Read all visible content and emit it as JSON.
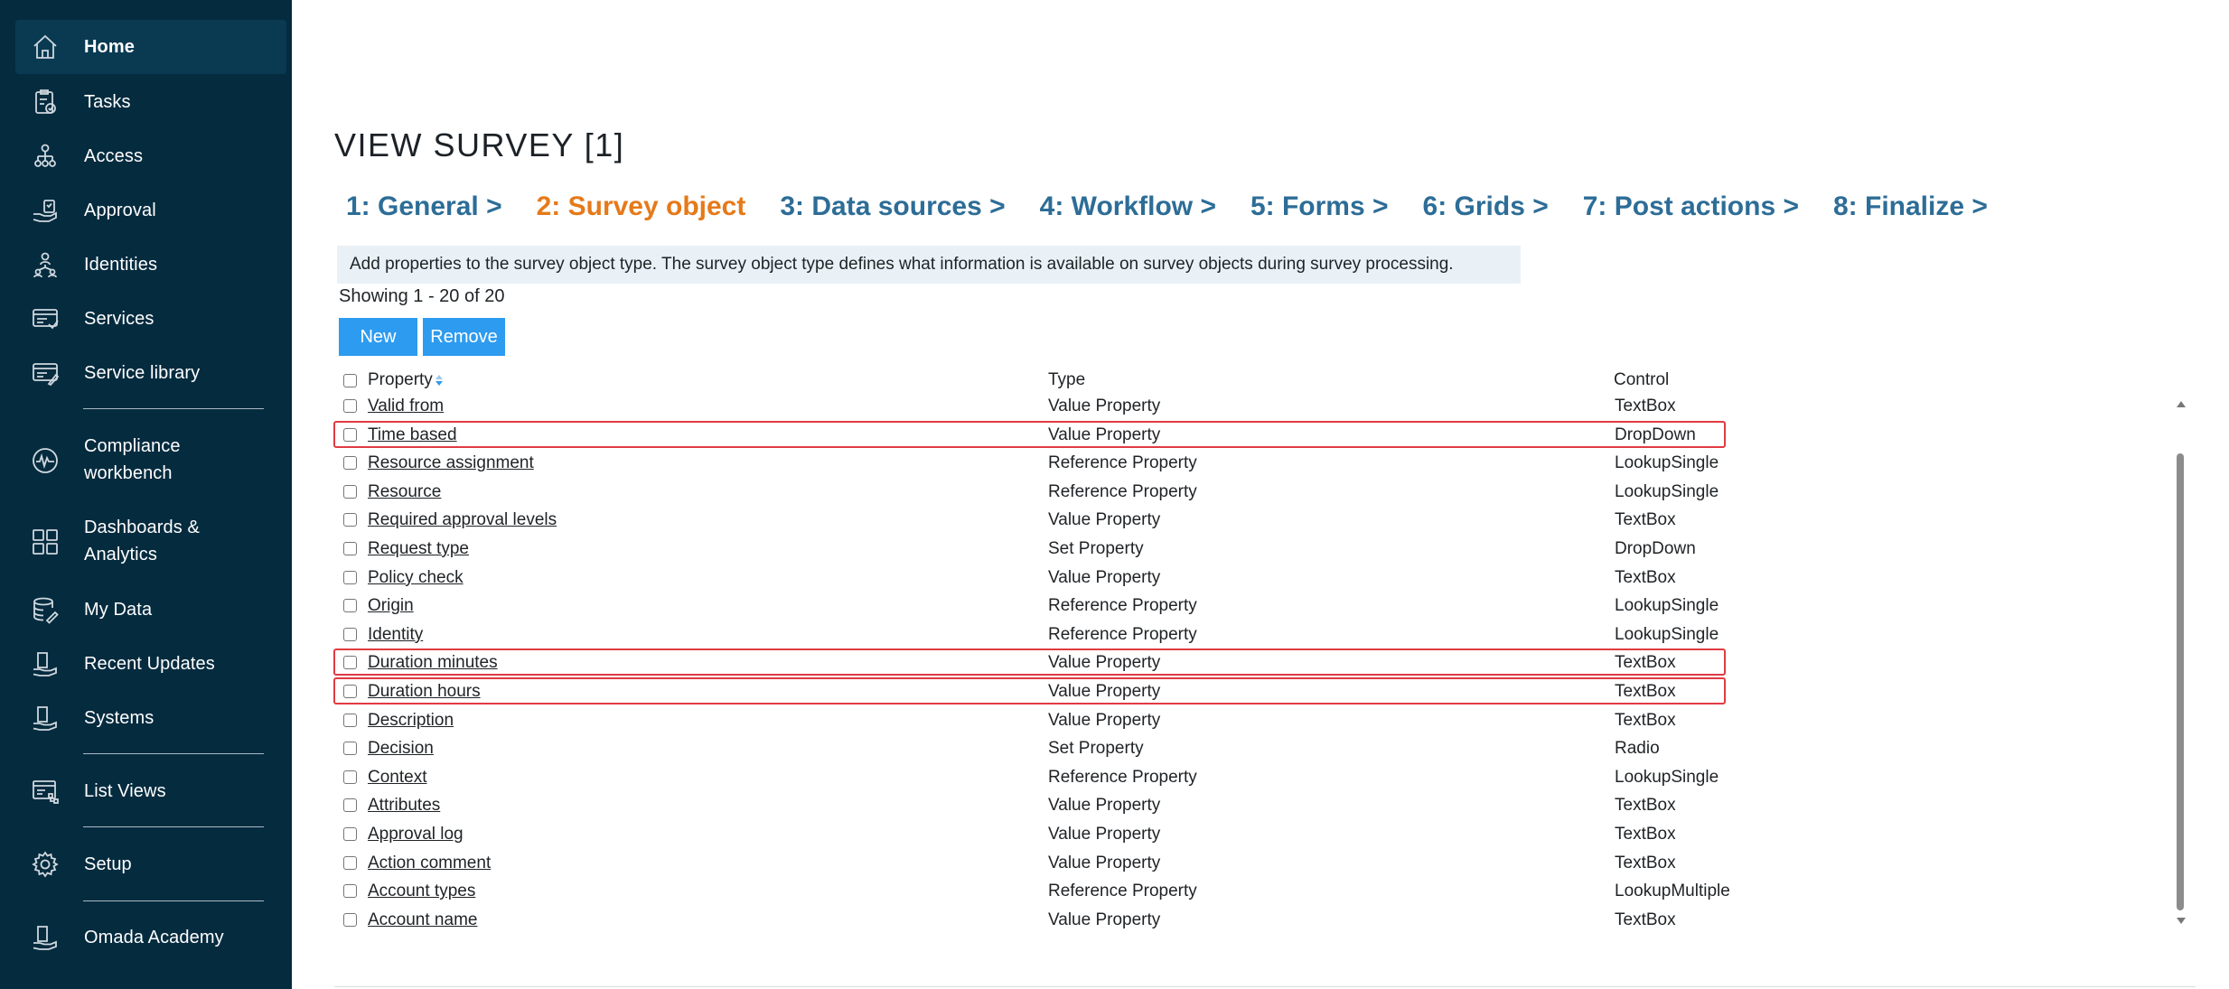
{
  "sidebar": {
    "items": [
      {
        "label": "Home",
        "icon": "home-icon"
      },
      {
        "label": "Tasks",
        "icon": "tasks-icon"
      },
      {
        "label": "Access",
        "icon": "access-icon"
      },
      {
        "label": "Approval",
        "icon": "approval-icon"
      },
      {
        "label": "Identities",
        "icon": "identities-icon"
      },
      {
        "label": "Services",
        "icon": "services-icon"
      },
      {
        "label": "Service library",
        "icon": "service-library-icon"
      },
      {
        "label_line1": "Compliance",
        "label_line2": "workbench",
        "icon": "compliance-icon"
      },
      {
        "label_line1": "Dashboards &",
        "label_line2": "Analytics",
        "icon": "dashboards-icon"
      },
      {
        "label": "My Data",
        "icon": "database-icon"
      },
      {
        "label": "Recent Updates",
        "icon": "recent-updates-icon"
      },
      {
        "label": "Systems",
        "icon": "systems-icon"
      },
      {
        "label": "List Views",
        "icon": "list-views-icon"
      },
      {
        "label": "Setup",
        "icon": "gear-icon"
      },
      {
        "label": "Omada Academy",
        "icon": "academy-icon"
      }
    ]
  },
  "page": {
    "title": "VIEW SURVEY [1]",
    "wizard_steps": [
      "1: General >",
      "2: Survey object",
      "3: Data sources >",
      "4: Workflow >",
      "5: Forms >",
      "6: Grids >",
      "7: Post actions >",
      "8: Finalize >"
    ],
    "current_step": "2: Survey object",
    "info": "Add properties to the survey object type. The survey object type defines what information is available on survey objects during survey processing.",
    "showing": "Showing 1 - 20 of 20",
    "buttons": {
      "new": "New",
      "remove": "Remove"
    }
  },
  "grid": {
    "headers": {
      "property": "Property",
      "type": "Type",
      "control": "Control"
    },
    "rows": [
      {
        "property": "Valid from",
        "type": "Value Property",
        "control": "TextBox",
        "highlighted": false
      },
      {
        "property": "Time based",
        "type": "Value Property",
        "control": "DropDown",
        "highlighted": true
      },
      {
        "property": "Resource assignment",
        "type": "Reference Property",
        "control": "LookupSingle",
        "highlighted": false
      },
      {
        "property": "Resource",
        "type": "Reference Property",
        "control": "LookupSingle",
        "highlighted": false
      },
      {
        "property": "Required approval levels",
        "type": "Value Property",
        "control": "TextBox",
        "highlighted": false
      },
      {
        "property": "Request type",
        "type": "Set Property",
        "control": "DropDown",
        "highlighted": false
      },
      {
        "property": "Policy check",
        "type": "Value Property",
        "control": "TextBox",
        "highlighted": false
      },
      {
        "property": "Origin",
        "type": "Reference Property",
        "control": "LookupSingle",
        "highlighted": false
      },
      {
        "property": "Identity",
        "type": "Reference Property",
        "control": "LookupSingle",
        "highlighted": false
      },
      {
        "property": "Duration minutes",
        "type": "Value Property",
        "control": "TextBox",
        "highlighted": true
      },
      {
        "property": "Duration hours",
        "type": "Value Property",
        "control": "TextBox",
        "highlighted": true
      },
      {
        "property": "Description",
        "type": "Value Property",
        "control": "TextBox",
        "highlighted": false
      },
      {
        "property": "Decision",
        "type": "Set Property",
        "control": "Radio",
        "highlighted": false
      },
      {
        "property": "Context",
        "type": "Reference Property",
        "control": "LookupSingle",
        "highlighted": false
      },
      {
        "property": "Attributes",
        "type": "Value Property",
        "control": "TextBox",
        "highlighted": false
      },
      {
        "property": "Approval log",
        "type": "Value Property",
        "control": "TextBox",
        "highlighted": false
      },
      {
        "property": "Action comment",
        "type": "Value Property",
        "control": "TextBox",
        "highlighted": false
      },
      {
        "property": "Account types",
        "type": "Reference Property",
        "control": "LookupMultiple",
        "highlighted": false
      },
      {
        "property": "Account name",
        "type": "Value Property",
        "control": "TextBox",
        "highlighted": false
      }
    ]
  },
  "colors": {
    "sidebar_bg": "#052b3f",
    "wizard_link": "#2d6d97",
    "wizard_current": "#e57a1a",
    "button_bg": "#2d9bf0",
    "highlight_border": "#e03b43",
    "info_bg": "#e9f1f7"
  }
}
